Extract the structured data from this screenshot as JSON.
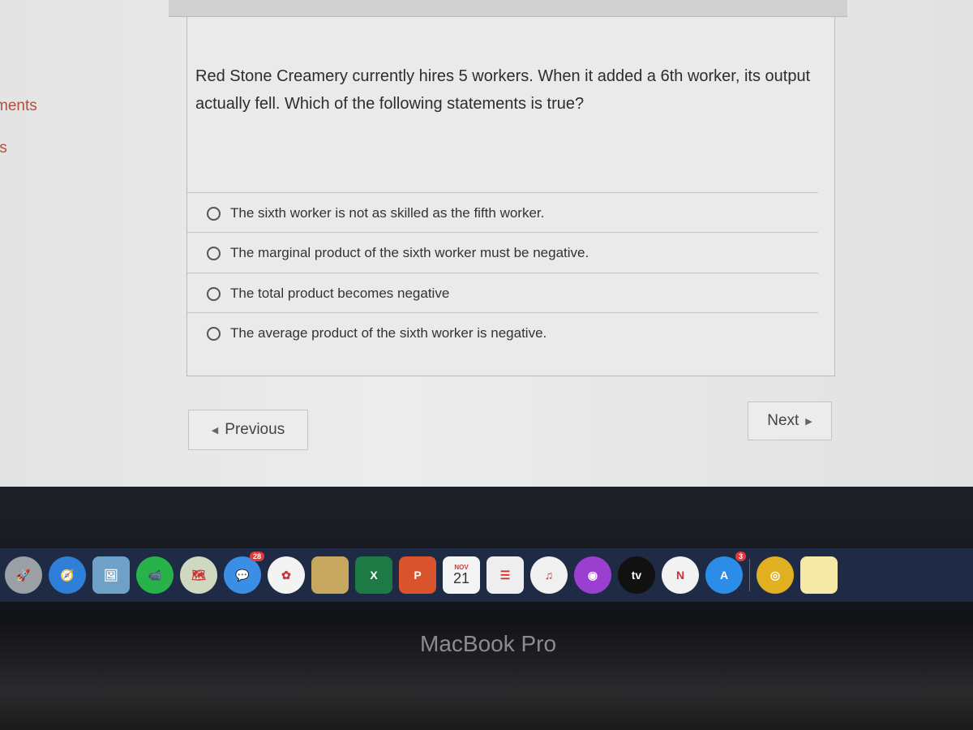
{
  "sidebar": {
    "items": [
      {
        "label": "ments"
      },
      {
        "label": "ts"
      }
    ]
  },
  "question": {
    "text": "Red Stone Creamery currently hires 5 workers. When it added a 6th worker, its output actually fell. Which of the following statements is true?",
    "options": [
      {
        "label": "The sixth worker is not as skilled as the fifth worker.",
        "selected": false
      },
      {
        "label": "The marginal product of the sixth worker must be negative.",
        "selected": false
      },
      {
        "label": "The total product becomes negative",
        "selected": false
      },
      {
        "label": "The average product of the sixth worker is negative.",
        "selected": false
      }
    ]
  },
  "nav": {
    "previous": "Previous",
    "next": "Next"
  },
  "dock": {
    "apps": [
      {
        "name": "launchpad",
        "glyph": "🚀",
        "color": "#9aa0a6"
      },
      {
        "name": "safari",
        "glyph": "🧭",
        "color": "#2f7fd8"
      },
      {
        "name": "preview",
        "glyph": "🖼",
        "color": "#6fa0c8"
      },
      {
        "name": "facetime",
        "glyph": "📹",
        "color": "#27b34a"
      },
      {
        "name": "maps",
        "glyph": "🗺",
        "color": "#cfd8c0"
      },
      {
        "name": "messages",
        "glyph": "💬",
        "color": "#3a8ee6",
        "badge": "28"
      },
      {
        "name": "photos",
        "glyph": "✿",
        "color": "#f3f3f3"
      },
      {
        "name": "notes-folder",
        "glyph": "",
        "color": "#c8a860"
      },
      {
        "name": "excel",
        "glyph": "X",
        "color": "#1e7a44"
      },
      {
        "name": "powerpoint",
        "glyph": "P",
        "color": "#d9532c"
      },
      {
        "name": "calendar",
        "glyph": "21",
        "color": "#f4f4f4",
        "month": "NOV"
      },
      {
        "name": "reminders",
        "glyph": "☰",
        "color": "#eeeeee"
      },
      {
        "name": "music",
        "glyph": "♫",
        "color": "#f0f0f0"
      },
      {
        "name": "podcasts",
        "glyph": "◉",
        "color": "#9b3fd1"
      },
      {
        "name": "apple-tv",
        "glyph": "tv",
        "color": "#111111"
      },
      {
        "name": "news",
        "glyph": "N",
        "color": "#f2f2f2"
      },
      {
        "name": "app-store",
        "glyph": "A",
        "color": "#2b8de8",
        "badge": "3"
      },
      {
        "name": "chrome",
        "glyph": "◎",
        "color": "#e0b020"
      },
      {
        "name": "notes",
        "glyph": "",
        "color": "#f5e9a8"
      }
    ]
  },
  "device": {
    "label": "MacBook Pro"
  }
}
